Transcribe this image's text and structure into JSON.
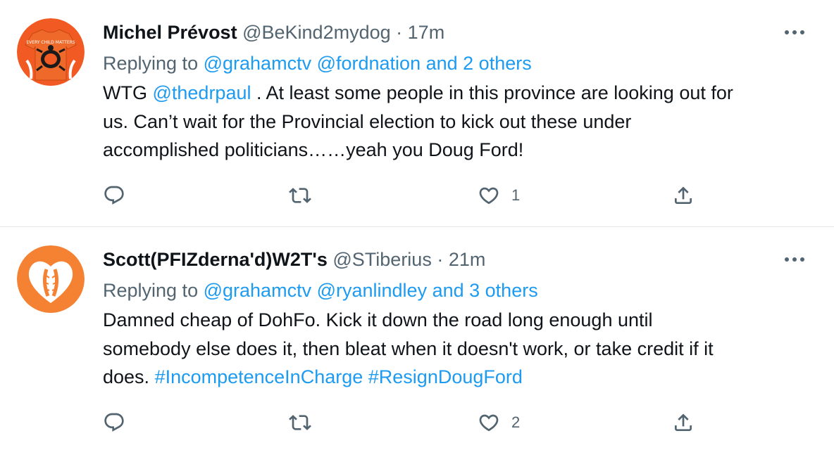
{
  "tweets": [
    {
      "display_name": "Michel Prévost",
      "handle": "@BeKind2mydog",
      "separator": "·",
      "time": "17m",
      "replying_to_label": "Replying to",
      "replying_mentions": [
        "@grahamctv",
        "@fordnation",
        "and 2 others"
      ],
      "body": {
        "line1_prefix": "WTG ",
        "line1_mention": "@thedrpaul",
        "line1_suffix": " . At least some people in this province are looking out for",
        "line2": "us. Can’t wait for the Provincial election to kick out these under",
        "line3": "accomplished politicians……yeah you Doug Ford!"
      },
      "avatar_text": "EVERY CHILD MATTERS",
      "avatar_bg": "#f15a22",
      "like_count": "1",
      "icons": {
        "more": "more-icon",
        "reply": "reply-icon",
        "retweet": "retweet-icon",
        "like": "heart-icon",
        "share": "share-icon"
      }
    },
    {
      "display_name": "Scott(PFIZderna'd)W2T's",
      "handle": "@STiberius",
      "separator": "·",
      "time": "21m",
      "replying_to_label": "Replying to",
      "replying_mentions": [
        "@grahamctv",
        "@ryanlindley",
        "and 3 others"
      ],
      "body": {
        "line1": "Damned cheap of DohFo. Kick it down the road long enough until",
        "line2": "somebody else does it, then bleat when it doesn't work, or take credit if it",
        "line3_prefix": "does. ",
        "hashtags": [
          "#IncompetenceInCharge",
          "#ResignDougFord"
        ]
      },
      "avatar_bg": "#f58233",
      "like_count": "2",
      "icons": {
        "more": "more-icon",
        "reply": "reply-icon",
        "retweet": "retweet-icon",
        "like": "heart-icon",
        "share": "share-icon"
      }
    }
  ],
  "colors": {
    "link": "#1d9bf0",
    "secondary_text": "#536471",
    "primary_text": "#0f1419",
    "divider": "#e3e6e9"
  }
}
